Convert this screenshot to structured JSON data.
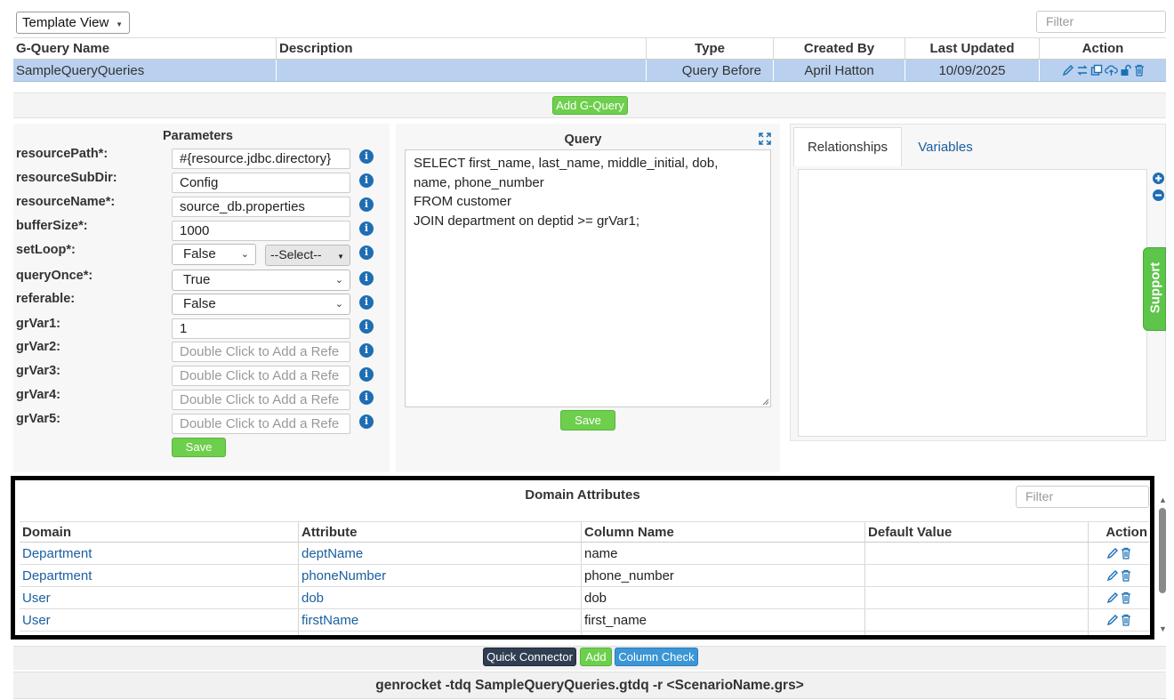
{
  "toolbar": {
    "view_select": "Template View",
    "filter_placeholder": "Filter"
  },
  "gquery_table": {
    "columns": [
      "G-Query Name",
      "Description",
      "Type",
      "Created By",
      "Last Updated",
      "Action"
    ],
    "rows": [
      {
        "name": "SampleQueryQueries",
        "description": "",
        "type": "Query Before",
        "created_by": "April Hatton",
        "last_updated": "10/09/2025"
      }
    ],
    "action_icons": [
      "edit-icon",
      "swap-icon",
      "copy-icon",
      "upload-icon",
      "unlock-icon",
      "delete-icon"
    ]
  },
  "add_gquery_label": "Add G-Query",
  "parameters": {
    "title": "Parameters",
    "items": [
      {
        "label": "resourcePath*:",
        "value": "#{resource.jdbc.directory}"
      },
      {
        "label": "resourceSubDir:",
        "value": "Config"
      },
      {
        "label": "resourceName*:",
        "value": "source_db.properties"
      },
      {
        "label": "bufferSize*:",
        "value": "1000"
      },
      {
        "label": "setLoop*:",
        "value": "False",
        "extra_select": "--Select--"
      },
      {
        "label": "queryOnce*:",
        "value": "True"
      },
      {
        "label": "referable:",
        "value": "False"
      },
      {
        "label": "grVar1:",
        "value": "1"
      },
      {
        "label": "grVar2:",
        "placeholder": "Double Click to Add a Refe"
      },
      {
        "label": "grVar3:",
        "placeholder": "Double Click to Add a Refe"
      },
      {
        "label": "grVar4:",
        "placeholder": "Double Click to Add a Refe"
      },
      {
        "label": "grVar5:",
        "placeholder": "Double Click to Add a Refe"
      }
    ],
    "save_label": "Save"
  },
  "query": {
    "title": "Query",
    "lines": [
      "SELECT first_name, last_name, middle_initial, dob,",
      "name, phone_number",
      "FROM customer",
      "JOIN department on deptid >= grVar1;"
    ],
    "save_label": "Save"
  },
  "right_panel": {
    "tabs": [
      "Relationships",
      "Variables"
    ],
    "active_tab": "Relationships"
  },
  "support_label": "Support",
  "domain_attributes": {
    "title": "Domain Attributes",
    "filter_placeholder": "Filter",
    "columns": [
      "Domain",
      "Attribute",
      "Column Name",
      "Default Value",
      "Action"
    ],
    "rows": [
      {
        "domain": "Department",
        "attribute": "deptName",
        "column": "name",
        "default": ""
      },
      {
        "domain": "Department",
        "attribute": "phoneNumber",
        "column": "phone_number",
        "default": ""
      },
      {
        "domain": "User",
        "attribute": "dob",
        "column": "dob",
        "default": ""
      },
      {
        "domain": "User",
        "attribute": "firstName",
        "column": "first_name",
        "default": ""
      }
    ]
  },
  "bottom_buttons": {
    "quick_connector": "Quick Connector",
    "add": "Add",
    "column_check": "Column Check"
  },
  "command_line": "genrocket -tdq SampleQueryQueries.gtdq -r <ScenarioName.grs>",
  "colors": {
    "selected_row": "#b9d1ee",
    "green_button": "#6dcf4c",
    "dark_button": "#2f3e52",
    "blue_button": "#3c96d6",
    "link": "#1a5fa0",
    "info_icon": "#1f6db3"
  }
}
